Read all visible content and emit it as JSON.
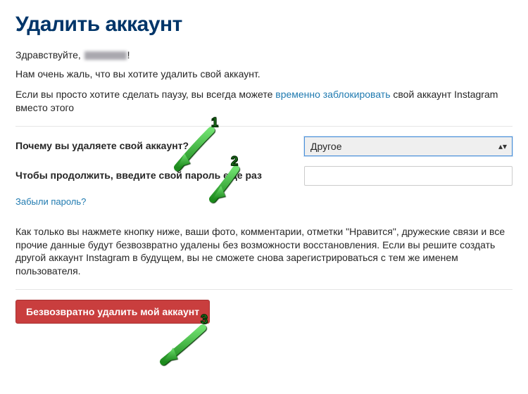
{
  "title": "Удалить аккаунт",
  "greeting_prefix": "Здравствуйте,",
  "greeting_suffix": "!",
  "sorry_text": "Нам очень жаль, что вы хотите удалить свой аккаунт.",
  "pause_before": "Если вы просто хотите сделать паузу, вы всегда можете ",
  "pause_link": "временно заблокировать",
  "pause_after": " свой аккаунт Instagram вместо этого",
  "form": {
    "reason_label": "Почему вы удаляете свой аккаунт?",
    "reason_value": "Другое",
    "password_label": "Чтобы продолжить, введите свой пароль еще раз",
    "password_value": ""
  },
  "forgot_link": "Забыли пароль?",
  "warning_text": "Как только вы нажмете кнопку ниже, ваши фото, комментарии, отметки \"Нравится\", дружеские связи и все прочие данные будут безвозвратно удалены без возможности восстановления. Если вы решите создать другой аккаунт Instagram в будущем, вы не сможете снова зарегистрироваться с тем же именем пользователя.",
  "delete_button": "Безвозвратно удалить мой аккаунт",
  "annotations": {
    "n1": "1",
    "n2": "2",
    "n3": "3"
  }
}
